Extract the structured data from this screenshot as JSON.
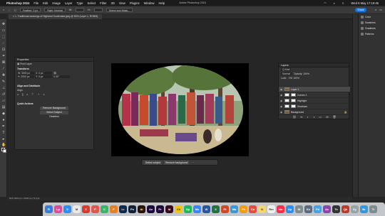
{
  "menubar": {
    "app": "Photoshop 2024",
    "items": [
      "File",
      "Edit",
      "Image",
      "Layer",
      "Type",
      "Select",
      "Filter",
      "3D",
      "View",
      "Plugins",
      "Window",
      "Help"
    ],
    "clock": "Wed 8 May 17:19:45"
  },
  "window": {
    "title": "Adobe Photoshop 2024"
  },
  "options_bar": {
    "feather_label": "Feather: 0 px",
    "style_label": "Style: Normal",
    "width_label": "W:",
    "height_label": "H:",
    "mask_button": "Select and Mask...",
    "share": "Share"
  },
  "document_tab": {
    "label": "1. Traditional weavings of Highland Guatemala.jpeg @ 50% (Layer 1, RGB/8)"
  },
  "properties": {
    "title": "Properties",
    "layer_type": "Pixel Layer",
    "transform_title": "Transform",
    "w_label": "W: 3000 px",
    "x_label": "X: 0 px",
    "h_label": "H: 2000 px",
    "y_label": "Y: 0 px",
    "angle_label": "0.00°",
    "align_title": "Align and Distribute",
    "align_sub": "Align:",
    "quick_title": "Quick Actions",
    "btn_remove_bg": "Remove Background",
    "btn_select_subject": "Select Subject",
    "btn_deselect": "Deselect"
  },
  "layers": {
    "title": "Layers",
    "kind": "Q Kind",
    "blend_mode": "Normal",
    "opacity_label": "Opacity: 100%",
    "lock_label": "Lock:",
    "fill_label": "Fill: 100%",
    "rows": [
      {
        "name": "Layer 1",
        "selected": true
      },
      {
        "name": "Curves 1",
        "selected": false
      },
      {
        "name": "Highlight",
        "selected": false
      },
      {
        "name": "Shadows",
        "selected": false
      },
      {
        "name": "Background",
        "selected": false
      }
    ]
  },
  "right_panel": {
    "items": [
      "Color",
      "Swatches",
      "Gradients",
      "Patterns"
    ]
  },
  "context_bar": {
    "select_subject": "Select subject",
    "remove_bg": "Remove background"
  },
  "status": {
    "text": "50%    3000 px x 2000 px (72 ppi)"
  },
  "dock": {
    "apps": [
      {
        "label": "Fi",
        "color": "#3a7bd5"
      },
      {
        "label": "Lp",
        "color": "#d64f9b"
      },
      {
        "label": "S",
        "color": "#2f8cf0"
      },
      {
        "label": "M",
        "color": "#e9e9e9"
      },
      {
        "label": "Z",
        "color": "#d93a2b"
      },
      {
        "label": "P",
        "color": "#e2574c"
      },
      {
        "label": "C",
        "color": "#3bb36a"
      },
      {
        "label": "F",
        "color": "#e67e22"
      },
      {
        "label": "Lr",
        "color": "#0f2a4a"
      },
      {
        "label": "Ps",
        "color": "#0f2238"
      },
      {
        "label": "Ai",
        "color": "#2b1500"
      },
      {
        "label": "Ae",
        "color": "#1b0a3a"
      },
      {
        "label": "Pr",
        "color": "#1f0a3a"
      },
      {
        "label": "Id",
        "color": "#3a0a1f"
      },
      {
        "label": "Ch",
        "color": "#f1c40f"
      },
      {
        "label": "Sp",
        "color": "#1db954"
      },
      {
        "label": "Ms",
        "color": "#3a86ff"
      },
      {
        "label": "W",
        "color": "#2b579a"
      },
      {
        "label": "X",
        "color": "#217346"
      },
      {
        "label": "Pt",
        "color": "#d24726"
      },
      {
        "label": "Ma",
        "color": "#3a9ad9"
      },
      {
        "label": "Ph",
        "color": "#f39c12"
      },
      {
        "label": "Ca",
        "color": "#e74c3c"
      },
      {
        "label": "N",
        "color": "#f5d76e"
      },
      {
        "label": "Rm",
        "color": "#ecf0f1"
      },
      {
        "label": "Mu",
        "color": "#fa2d48"
      },
      {
        "label": "Ap",
        "color": "#2f8cf0"
      },
      {
        "label": "St",
        "color": "#7f8c8d"
      },
      {
        "label": "Ke",
        "color": "#5b6c7d"
      },
      {
        "label": "Fd",
        "color": "#4aa3df"
      },
      {
        "label": "Ac",
        "color": "#8e44ad"
      },
      {
        "label": "Te",
        "color": "#333333"
      },
      {
        "label": "Qk",
        "color": "#c0392b"
      },
      {
        "label": "Sy",
        "color": "#95a5a6"
      },
      {
        "label": "Br",
        "color": "#3498db"
      },
      {
        "label": "Tr",
        "color": "#7f8c8d"
      }
    ]
  }
}
